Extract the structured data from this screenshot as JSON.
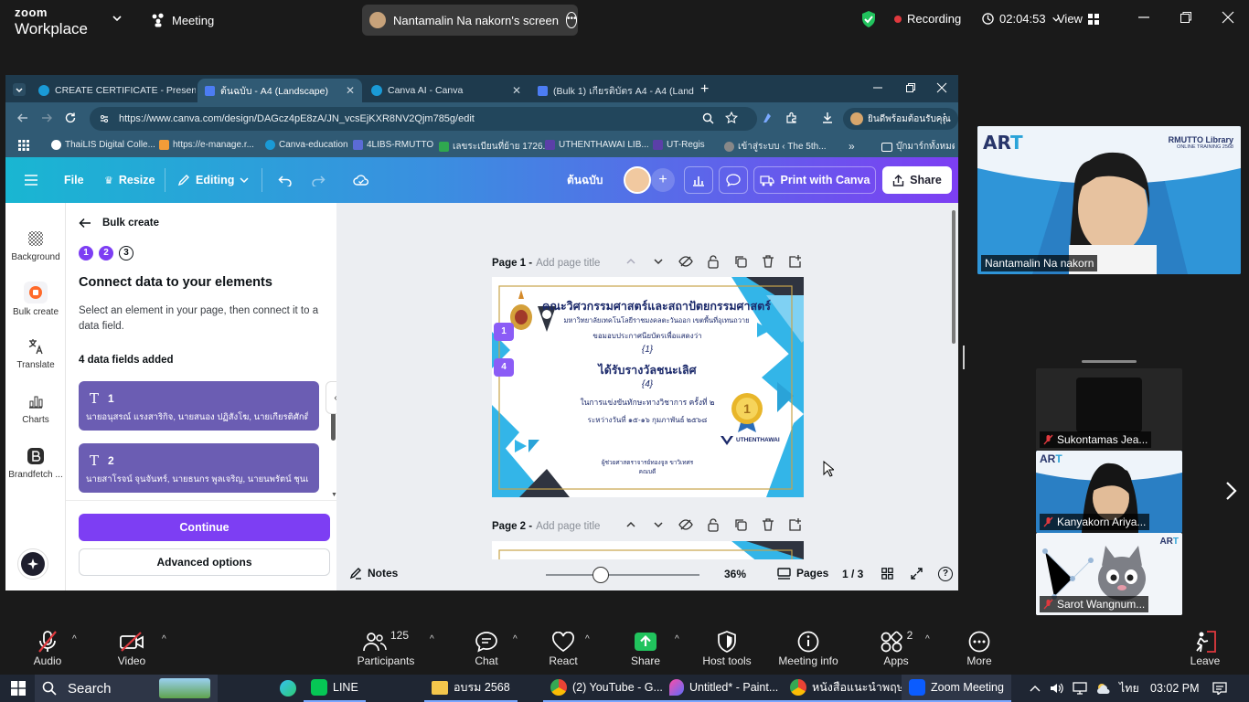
{
  "zoom": {
    "logo_top": "zoom",
    "logo_bottom": "Workplace",
    "meeting_label": "Meeting",
    "share_title": "Nantamalin Na nakorn's screen",
    "recording_label": "Recording",
    "timer": "02:04:53",
    "view_label": "View"
  },
  "browser": {
    "tabs": [
      {
        "title": "CREATE CERTIFICATE - Presenta"
      },
      {
        "title": "ต้นฉบับ - A4 (Landscape)"
      },
      {
        "title": "Canva AI - Canva"
      },
      {
        "title": "(Bulk 1) เกียรติบัตร A4 - A4 (Land"
      }
    ],
    "url": "https://www.canva.com/design/DAGcz4pE8zA/JN_vcsEjKXR8NV2Qjm785g/edit",
    "profile_label": "ยินดีพร้อมต้อนรับคุณ",
    "bookmarks": [
      "ThaiLIS Digital Colle...",
      "https://e-manage.r...",
      "Canva-education",
      "4LIBS-RMUTTO",
      "เลขระเบียนที่ย้าย 1726...",
      "UTHENTHAWAI LIB...",
      "UT-Regis",
      "เข้าสู่ระบบ ‹ The 5th..."
    ],
    "bookmark_folder": "บุ๊กมาร์กทั้งหมด"
  },
  "canva": {
    "menu_file": "File",
    "menu_resize": "Resize",
    "menu_editing": "Editing",
    "doc_title": "ต้นฉบับ",
    "print_label": "Print with Canva",
    "share_label": "Share",
    "sidebar": [
      {
        "label": "Background",
        "icon": "background-icon"
      },
      {
        "label": "Bulk create",
        "icon": "bulk-create-icon"
      },
      {
        "label": "Translate",
        "icon": "translate-icon"
      },
      {
        "label": "Charts",
        "icon": "charts-icon"
      },
      {
        "label": "Brandfetch ...",
        "icon": "brandfetch-icon"
      }
    ],
    "panel": {
      "back_title": "Bulk create",
      "steps": [
        "1",
        "2",
        "3"
      ],
      "heading": "Connect data to your elements",
      "description": "Select an element in your page, then connect it to a data field.",
      "fields_count": "4 data fields added",
      "fields": [
        {
          "name": "1",
          "preview": "นายอนุสรณ์ แรงสาริกิจ, นายสนอง ปฏิสังโฆ, นายเกียรติศักดิ์ ..."
        },
        {
          "name": "2",
          "preview": "นายสาโรจน์ จุนจันทร์, นายธนกร พูลเจริญ, นายนพรัตน์ ชุนเต็..."
        }
      ],
      "continue_label": "Continue",
      "advanced_label": "Advanced options"
    },
    "pages": [
      {
        "label": "Page 1 -",
        "placeholder": "Add page title"
      },
      {
        "label": "Page 2 -",
        "placeholder": "Add page title"
      }
    ],
    "certificate": {
      "org_name": "คณะวิศวกรรมศาสตร์และสถาปัตยกรรมศาสตร์",
      "university": "มหาวิทยาลัยเทคโนโลยีราชมงคลตะวันออก เขตพื้นที่อุเทนถวาย",
      "intro": "ขอมอบประกาศนียบัตรเพื่อแสดงว่า",
      "field1": "{1}",
      "award": "ได้รับรางวัลชนะเลิศ",
      "field4": "{4}",
      "event": "ในการแข่งขันทักษะทางวิชาการ ครั้งที่ ๒",
      "date": "ระหว่างวันที่ ๑๕-๑๖ กุมภาพันธ์ ๒๕๖๘",
      "signer": "ผู้ช่วยศาสตราจารย์ทองจูล ขาวิเทศร",
      "signer_title": "คณบดี",
      "medal_num": "1",
      "logo_text": "UTHENTHAWAI",
      "marker1": "1",
      "marker4": "4"
    },
    "bottom": {
      "notes_label": "Notes",
      "zoom_pct": "36%",
      "zoom_level": 0.36,
      "pages_label": "Pages",
      "page_count": "1 / 3"
    }
  },
  "participants": {
    "speaker": "Nantamalin Na nakorn",
    "speaker_banner": "RMUTTO Library",
    "speaker_banner_sub": "ONLINE TRAINING 2568",
    "list": [
      {
        "name": "Sukontamas Jea..."
      },
      {
        "name": "Kanyakorn Ariya..."
      },
      {
        "name": "Sarot Wangnum..."
      }
    ]
  },
  "toolbar": {
    "audio": "Audio",
    "video": "Video",
    "participants": "Participants",
    "participants_count": "125",
    "chat": "Chat",
    "react": "React",
    "share": "Share",
    "host_tools": "Host tools",
    "meeting_info": "Meeting info",
    "apps": "Apps",
    "apps_count": "2",
    "more": "More",
    "leave": "Leave"
  },
  "taskbar": {
    "search": "Search",
    "items": [
      "LINE",
      "อบรม 2568",
      "(2) YouTube - G...",
      "Untitled* - Paint...",
      "หนังสือแนะนำพฤษ...",
      "Zoom Meeting"
    ],
    "lang": "ไทย",
    "time": "03:02 PM"
  },
  "colors": {
    "canva_purple": "#7d3ef3",
    "field_card": "#6b5db3",
    "zoom_green": "#21c35d",
    "record_red": "#e0393e"
  }
}
